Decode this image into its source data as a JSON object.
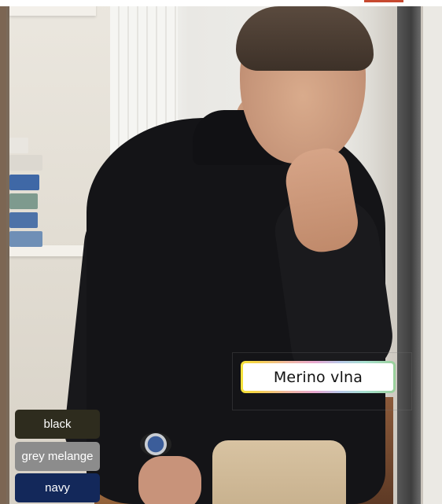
{
  "product_image": {
    "alt": "",
    "material_badge": {
      "label": "Merino vlna",
      "border_colors": [
        "#f5e33a",
        "#f0b8a0",
        "#e8a8d0",
        "#b8c8e8",
        "#a8e0d0",
        "#9ad09a"
      ]
    }
  },
  "color_options": [
    {
      "label": "black",
      "color": "#2e2c1e"
    },
    {
      "label": "grey melange",
      "color": "#8c8c8c"
    },
    {
      "label": "navy",
      "color": "#13285a"
    }
  ]
}
